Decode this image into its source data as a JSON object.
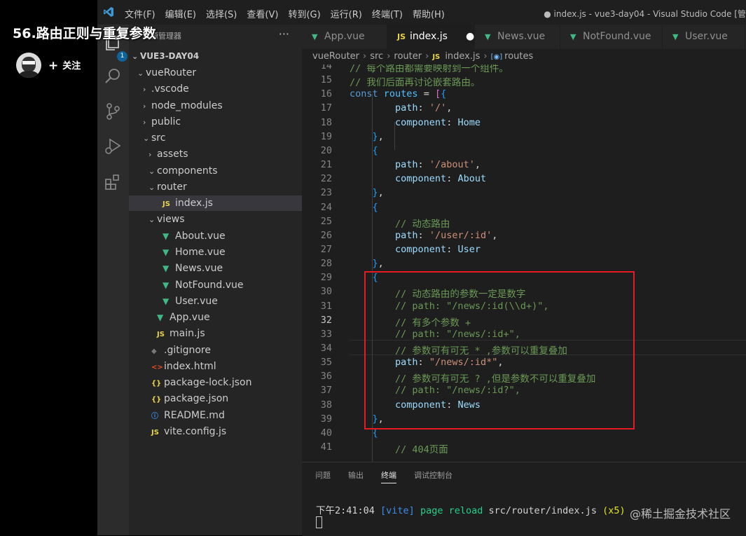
{
  "video": {
    "title": "56.路由正则与重复参数",
    "follow_label": "关注"
  },
  "titlebar": {
    "menus": [
      "文件(F)",
      "编辑(E)",
      "选择(S)",
      "查看(V)",
      "转到(G)",
      "运行(R)",
      "终端(T)",
      "帮助(H)"
    ],
    "window_title": "● index.js - vue3-day04 - Visual Studio Code [管"
  },
  "activity_bar": {
    "badge": "1",
    "icons": [
      "explorer-icon",
      "search-icon",
      "source-control-icon",
      "run-debug-icon",
      "extensions-icon"
    ]
  },
  "sidebar": {
    "header": "资源管理器",
    "more": "···",
    "project": "VUE3-DAY04",
    "items": [
      {
        "label": "vueRouter",
        "twisty": "⌄",
        "icon": "",
        "depth": 1
      },
      {
        "label": ".vscode",
        "twisty": "›",
        "icon": "",
        "depth": 2
      },
      {
        "label": "node_modules",
        "twisty": "›",
        "icon": "",
        "depth": 2
      },
      {
        "label": "public",
        "twisty": "›",
        "icon": "",
        "depth": 2
      },
      {
        "label": "src",
        "twisty": "⌄",
        "icon": "",
        "depth": 2
      },
      {
        "label": "assets",
        "twisty": "›",
        "icon": "",
        "depth": 3
      },
      {
        "label": "components",
        "twisty": "⌄",
        "icon": "",
        "depth": 3
      },
      {
        "label": "router",
        "twisty": "⌄",
        "icon": "",
        "depth": 3
      },
      {
        "label": "index.js",
        "twisty": "",
        "icon": "JS",
        "depth": 4,
        "selected": true
      },
      {
        "label": "views",
        "twisty": "⌄",
        "icon": "",
        "depth": 3
      },
      {
        "label": "About.vue",
        "twisty": "",
        "icon": "▼",
        "depth": 4
      },
      {
        "label": "Home.vue",
        "twisty": "",
        "icon": "▼",
        "depth": 4
      },
      {
        "label": "News.vue",
        "twisty": "",
        "icon": "▼",
        "depth": 4
      },
      {
        "label": "NotFound.vue",
        "twisty": "",
        "icon": "▼",
        "depth": 4
      },
      {
        "label": "User.vue",
        "twisty": "",
        "icon": "▼",
        "depth": 4
      },
      {
        "label": "App.vue",
        "twisty": "",
        "icon": "▼",
        "depth": 3
      },
      {
        "label": "main.js",
        "twisty": "",
        "icon": "JS",
        "depth": 3
      },
      {
        "label": ".gitignore",
        "twisty": "",
        "icon": "◆",
        "depth": 2
      },
      {
        "label": "index.html",
        "twisty": "",
        "icon": "<>",
        "depth": 2
      },
      {
        "label": "package-lock.json",
        "twisty": "",
        "icon": "{}",
        "depth": 2
      },
      {
        "label": "package.json",
        "twisty": "",
        "icon": "{}",
        "depth": 2
      },
      {
        "label": "README.md",
        "twisty": "",
        "icon": "ⓘ",
        "depth": 2
      },
      {
        "label": "vite.config.js",
        "twisty": "",
        "icon": "JS",
        "depth": 2
      }
    ]
  },
  "tabs": [
    {
      "label": "App.vue",
      "icon": "▼",
      "active": false,
      "dirty": ""
    },
    {
      "label": "index.js",
      "icon": "JS",
      "active": true,
      "dirty": "●"
    },
    {
      "label": "News.vue",
      "icon": "▼",
      "active": false,
      "dirty": ""
    },
    {
      "label": "NotFound.vue",
      "icon": "▼",
      "active": false,
      "dirty": ""
    },
    {
      "label": "User.vue",
      "icon": "▼",
      "active": false,
      "dirty": ""
    }
  ],
  "breadcrumbs": [
    "vueRouter",
    "src",
    "router",
    "index.js",
    "routes"
  ],
  "editor": {
    "current_line": 32,
    "lines": [
      {
        "n": 14,
        "tokens": [
          [
            "cm",
            "// 每个路由都需要映射到一个组件。"
          ]
        ]
      },
      {
        "n": 15,
        "tokens": [
          [
            "cm",
            "// 我们后面再讨论嵌套路由。"
          ]
        ]
      },
      {
        "n": 16,
        "tokens": [
          [
            "kw",
            "const "
          ],
          [
            "var",
            "routes"
          ],
          [
            "",
            " = "
          ],
          [
            "br",
            "["
          ],
          [
            "br2",
            "{"
          ]
        ]
      },
      {
        "n": 17,
        "tokens": [
          [
            "",
            "        "
          ],
          [
            "prop",
            "path"
          ],
          [
            "",
            ": "
          ],
          [
            "str",
            "'/'"
          ],
          [
            "",
            ","
          ]
        ]
      },
      {
        "n": 18,
        "tokens": [
          [
            "",
            "        "
          ],
          [
            "prop",
            "component"
          ],
          [
            "",
            ": "
          ],
          [
            "prop",
            "Home"
          ]
        ]
      },
      {
        "n": 19,
        "tokens": [
          [
            "",
            "    "
          ],
          [
            "br2",
            "}"
          ],
          [
            "",
            ","
          ]
        ]
      },
      {
        "n": 20,
        "tokens": [
          [
            "",
            "    "
          ],
          [
            "br2",
            "{"
          ]
        ]
      },
      {
        "n": 21,
        "tokens": [
          [
            "",
            "        "
          ],
          [
            "prop",
            "path"
          ],
          [
            "",
            ": "
          ],
          [
            "str",
            "'/about'"
          ],
          [
            "",
            ","
          ]
        ]
      },
      {
        "n": 22,
        "tokens": [
          [
            "",
            "        "
          ],
          [
            "prop",
            "component"
          ],
          [
            "",
            ": "
          ],
          [
            "prop",
            "About"
          ]
        ]
      },
      {
        "n": 23,
        "tokens": [
          [
            "",
            "    "
          ],
          [
            "br2",
            "}"
          ],
          [
            "",
            ","
          ]
        ]
      },
      {
        "n": 24,
        "tokens": [
          [
            "",
            "    "
          ],
          [
            "br2",
            "{"
          ]
        ]
      },
      {
        "n": 25,
        "tokens": [
          [
            "",
            "        "
          ],
          [
            "cm",
            "// 动态路由"
          ]
        ]
      },
      {
        "n": 26,
        "tokens": [
          [
            "",
            "        "
          ],
          [
            "prop",
            "path"
          ],
          [
            "",
            ": "
          ],
          [
            "str",
            "'/user/:id'"
          ],
          [
            "",
            ","
          ]
        ]
      },
      {
        "n": 27,
        "tokens": [
          [
            "",
            "        "
          ],
          [
            "prop",
            "component"
          ],
          [
            "",
            ": "
          ],
          [
            "prop",
            "User"
          ]
        ]
      },
      {
        "n": 28,
        "tokens": [
          [
            "",
            "    "
          ],
          [
            "br2",
            "}"
          ],
          [
            "",
            ","
          ]
        ]
      },
      {
        "n": 29,
        "tokens": [
          [
            "",
            "    "
          ],
          [
            "br2",
            "{"
          ]
        ]
      },
      {
        "n": 30,
        "tokens": [
          [
            "",
            "        "
          ],
          [
            "cm",
            "// 动态路由的参数一定是数字"
          ]
        ]
      },
      {
        "n": 31,
        "tokens": [
          [
            "",
            "        "
          ],
          [
            "cm",
            "// path: \"/news/:id(\\\\d+)\","
          ]
        ]
      },
      {
        "n": 32,
        "tokens": [
          [
            "",
            "        "
          ],
          [
            "cm",
            "// 有多个参数 +"
          ]
        ]
      },
      {
        "n": 33,
        "tokens": [
          [
            "",
            "        "
          ],
          [
            "cm",
            "// path: \"/news/:id+\","
          ]
        ]
      },
      {
        "n": 34,
        "tokens": [
          [
            "",
            "        "
          ],
          [
            "cm",
            "// 参数可有可无 * ,参数可以重复叠加"
          ]
        ]
      },
      {
        "n": 35,
        "tokens": [
          [
            "",
            "        "
          ],
          [
            "prop",
            "path"
          ],
          [
            "",
            ": "
          ],
          [
            "str",
            "\"/news/:id*\""
          ],
          [
            "",
            ","
          ]
        ]
      },
      {
        "n": 36,
        "tokens": [
          [
            "",
            "        "
          ],
          [
            "cm",
            "// 参数可有可无 ? ,但是参数不可以重复叠加"
          ]
        ]
      },
      {
        "n": 37,
        "tokens": [
          [
            "",
            "        "
          ],
          [
            "cm",
            "// path: \"/news/:id?\","
          ]
        ]
      },
      {
        "n": 38,
        "tokens": [
          [
            "",
            "        "
          ],
          [
            "prop",
            "component"
          ],
          [
            "",
            ": "
          ],
          [
            "prop",
            "News"
          ]
        ]
      },
      {
        "n": 39,
        "tokens": [
          [
            "",
            "    "
          ],
          [
            "br2",
            "}"
          ],
          [
            "",
            ","
          ]
        ]
      },
      {
        "n": 40,
        "tokens": [
          [
            "",
            "    "
          ],
          [
            "br2",
            "{"
          ]
        ]
      },
      {
        "n": 41,
        "tokens": [
          [
            "",
            "        "
          ],
          [
            "cm",
            "// 404页面"
          ]
        ]
      }
    ]
  },
  "panel": {
    "tabs": [
      "问题",
      "输出",
      "终端",
      "调试控制台"
    ],
    "active_tab": "终端",
    "terminal": {
      "time": "下午2:41:04",
      "tag": "[vite]",
      "msg": "page reload",
      "path": "src/router/index.js",
      "count": "(x5)"
    }
  },
  "watermark": "@稀土掘金技术社区",
  "colors": {
    "highlight_border": "#e51c23",
    "vue_icon": "#41b883",
    "js_icon": "#e8d44d",
    "accent": "#0e639c"
  }
}
